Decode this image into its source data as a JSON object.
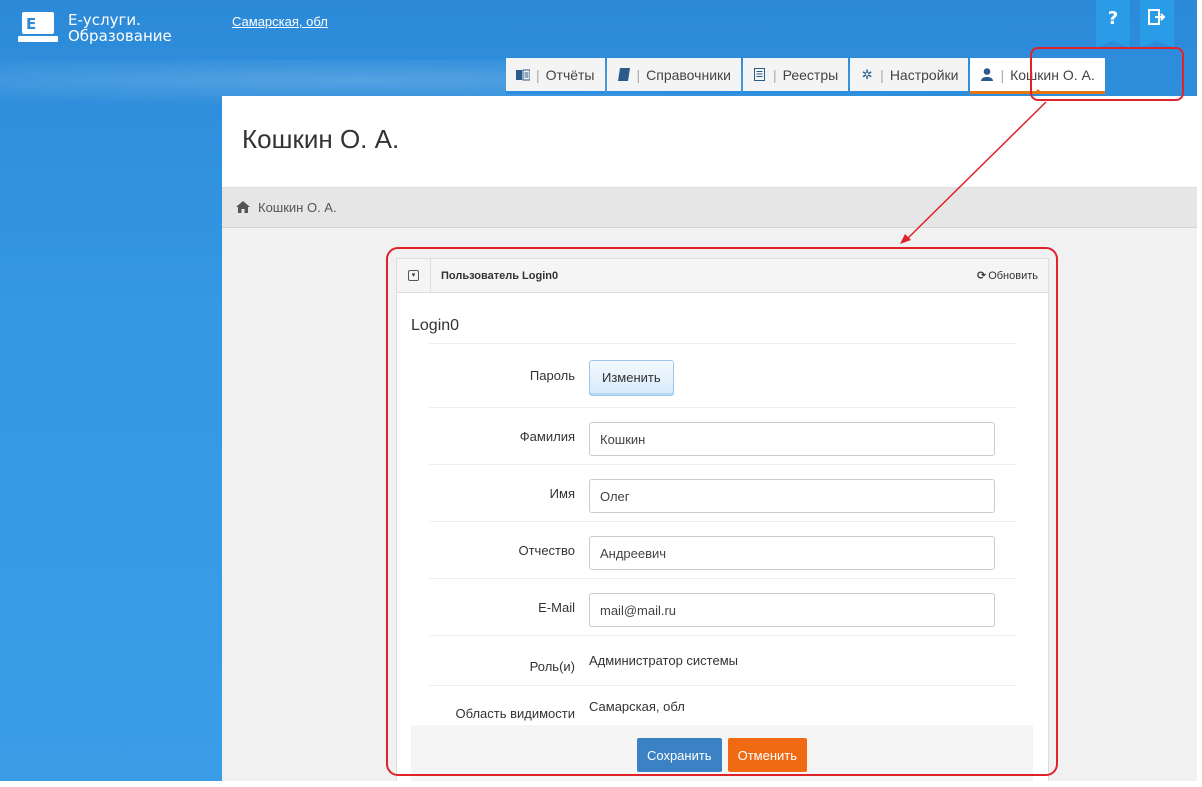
{
  "app": {
    "title_line1": "Е-услуги.",
    "title_line2": "Образование",
    "region_link": "Самарская, обл",
    "help_label": "?",
    "exit_label": "↪"
  },
  "nav": {
    "tabs": [
      {
        "icon": "reports-icon",
        "label": "Отчёты"
      },
      {
        "icon": "book-icon",
        "label": "Справочники"
      },
      {
        "icon": "registry-icon",
        "label": "Реестры"
      },
      {
        "icon": "gear-icon",
        "label": "Настройки"
      },
      {
        "icon": "user-icon",
        "label": "Кошкин О. А.",
        "active": true
      }
    ]
  },
  "page": {
    "title": "Кошкин О. А.",
    "breadcrumb": "Кошкин О. А."
  },
  "card": {
    "header_title": "Пользователь Login0",
    "refresh_label": "Обновить",
    "login_title": "Login0",
    "password_label": "Пароль",
    "change_button": "Изменить",
    "surname_label": "Фамилия",
    "surname_value": "Кошкин",
    "name_label": "Имя",
    "name_value": "Олег",
    "patronymic_label": "Отчество",
    "patronymic_value": "Андреевич",
    "email_label": "E-Mail",
    "email_value": "mail@mail.ru",
    "role_label": "Роль(и)",
    "role_value": "Администратор системы",
    "scope_label": "Область видимости",
    "scope_value": "Самарская, обл",
    "save_button": "Сохранить",
    "cancel_button": "Отменить"
  },
  "colors": {
    "accent": "#2b8ee0",
    "active_tab": "#e8760f",
    "save": "#3b82c4",
    "cancel": "#ef6a12",
    "annotation": "#e0222a"
  }
}
